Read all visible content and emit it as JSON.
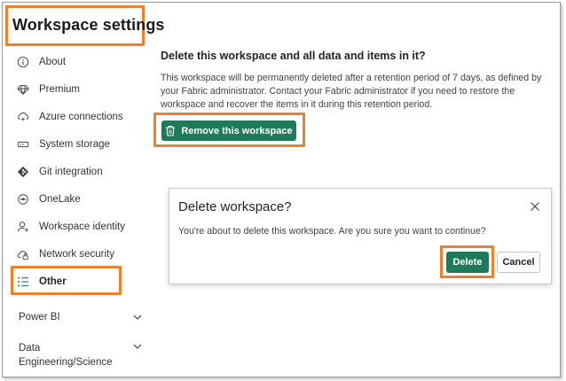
{
  "page": {
    "title": "Workspace settings"
  },
  "sidebar": {
    "items": [
      {
        "label": "About",
        "icon": "info-icon"
      },
      {
        "label": "Premium",
        "icon": "diamond-icon"
      },
      {
        "label": "Azure connections",
        "icon": "cloud-link-icon"
      },
      {
        "label": "System storage",
        "icon": "storage-icon"
      },
      {
        "label": "Git integration",
        "icon": "git-icon"
      },
      {
        "label": "OneLake",
        "icon": "onelake-icon"
      },
      {
        "label": "Workspace identity",
        "icon": "identity-icon"
      },
      {
        "label": "Network security",
        "icon": "cloud-lock-icon"
      },
      {
        "label": "Other",
        "icon": "list-icon",
        "selected": true
      }
    ],
    "groups": [
      {
        "label": "Power BI"
      },
      {
        "label": "Data Engineering/Science"
      }
    ]
  },
  "main": {
    "heading": "Delete this workspace and all data and items in it?",
    "description": "This workspace will be permanently deleted after a retention period of 7 days, as defined by your Fabric administrator. Contact your Fabric administrator if you need to restore the workspace and recover the items in it during this retention period.",
    "remove_button": "Remove this workspace"
  },
  "dialog": {
    "title": "Delete workspace?",
    "message": "You're about to delete this workspace. Are you sure you want to continue?",
    "delete_label": "Delete",
    "cancel_label": "Cancel"
  },
  "colors": {
    "accent": "#1f7a5a",
    "highlight": "#f07f2a",
    "selected_icon": "#1f7a5a"
  }
}
